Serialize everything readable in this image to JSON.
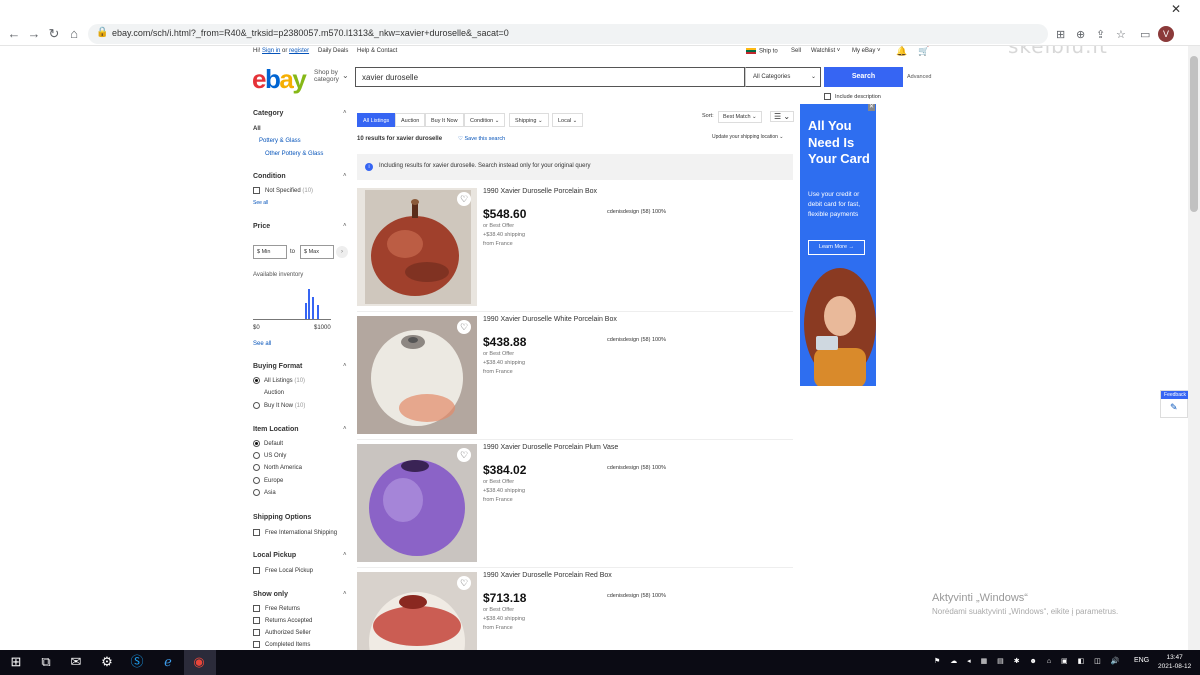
{
  "browser": {
    "url": "ebay.com/sch/i.html?_from=R40&_trksid=p2380057.m570.l1313&_nkw=xavier+duroselle&_sacat=0",
    "avatar_letter": "V",
    "close_glyph": "✕"
  },
  "header": {
    "greeting_prefix": "Hi!",
    "sign_in": "Sign in",
    "or": "or",
    "register": "register",
    "daily_deals": "Daily Deals",
    "help": "Help & Contact",
    "ship_to": "Ship to",
    "sell": "Sell",
    "watchlist": "Watchlist",
    "my_ebay": "My eBay",
    "shop_by": "Shop by",
    "category": "category",
    "search_value": "xavier duroselle",
    "category_select": "All Categories",
    "search_button": "Search",
    "advanced": "Advanced",
    "include_description": "Include description",
    "watermark": "skelbiu.lt"
  },
  "sidebar": {
    "category_heading": "Category",
    "category_all": "All",
    "category_1": "Pottery & Glass",
    "category_2": "Other Pottery & Glass",
    "condition_heading": "Condition",
    "condition_1": "Not Specified",
    "condition_1_count": "(10)",
    "see_all_1": "See all",
    "price_heading": "Price",
    "price_min": "$ Min",
    "price_to": "to",
    "price_max": "$ Max",
    "available_inventory": "Available inventory",
    "price_low": "$0",
    "price_high": "$1000",
    "see_all_2": "See all",
    "buying_heading": "Buying Format",
    "buying_1": "All Listings",
    "buying_1_count": "(10)",
    "buying_2": "Auction",
    "buying_3": "Buy It Now",
    "buying_3_count": "(10)",
    "location_heading": "Item Location",
    "loc_1": "Default",
    "loc_2": "US Only",
    "loc_3": "North America",
    "loc_4": "Europe",
    "loc_5": "Asia",
    "shipping_heading": "Shipping Options",
    "ship_1": "Free International Shipping",
    "pickup_heading": "Local Pickup",
    "pickup_1": "Free Local Pickup",
    "show_heading": "Show only",
    "show_1": "Free Returns",
    "show_2": "Returns Accepted",
    "show_3": "Authorized Seller",
    "show_4": "Completed Items"
  },
  "results": {
    "tabs": [
      "All Listings",
      "Auction",
      "Buy It Now"
    ],
    "filter_condition": "Condition",
    "filter_shipping": "Shipping",
    "filter_local": "Local",
    "sort_label": "Sort:",
    "sort_value": "Best Match",
    "count_text": "10 results for xavier duroselle",
    "save_search": "Save this search",
    "shipping_location": "Update your shipping location",
    "notice": "Including results for xavier duroselle. Search instead only for your original query",
    "items": [
      {
        "title": "1990 Xavier Duroselle Porcelain Box",
        "price": "$548.60",
        "offer": "or Best Offer",
        "shipping": "+$38.40 shipping",
        "from": "from France",
        "seller": "cdenisdesign (58) 100%"
      },
      {
        "title": "1990 Xavier Duroselle White Porcelain Box",
        "price": "$438.88",
        "offer": "or Best Offer",
        "shipping": "+$38.40 shipping",
        "from": "from France",
        "seller": "cdenisdesign (58) 100%"
      },
      {
        "title": "1990 Xavier Duroselle Porcelain Plum Vase",
        "price": "$384.02",
        "offer": "or Best Offer",
        "shipping": "+$38.40 shipping",
        "from": "from France",
        "seller": "cdenisdesign (58) 100%"
      },
      {
        "title": "1990 Xavier Duroselle Porcelain Red Box",
        "price": "$713.18",
        "offer": "or Best Offer",
        "shipping": "+$38.40 shipping",
        "from": "from France",
        "seller": "cdenisdesign (58) 100%"
      }
    ]
  },
  "ad": {
    "headline": "All You Need Is Your Card",
    "body": "Use your credit or debit card for fast, flexible payments",
    "cta": "Learn More →"
  },
  "feedback": "Feedback",
  "windows": {
    "activate_title": "Aktyvinti „Windows“",
    "activate_text": "Norėdami suaktyvinti „Windows“, eikite į parametrus.",
    "lang": "ENG",
    "time": "13:47",
    "date": "2021-08-12"
  },
  "colors": {
    "ebay_red": "#e53238",
    "ebay_blue": "#0064d2",
    "ebay_yellow": "#f5af02",
    "ebay_green": "#86b817",
    "accent": "#3665f3"
  }
}
